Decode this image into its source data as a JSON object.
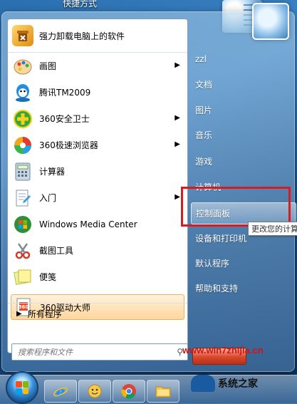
{
  "desktop": {
    "shortcut_label": "快捷方式"
  },
  "left_menu": {
    "pinned": {
      "label": "强力卸载电脑上的软件",
      "icon": "uninstall-icon"
    },
    "items": [
      {
        "label": "画图",
        "icon": "paint-icon",
        "has_submenu": true
      },
      {
        "label": "腾讯TM2009",
        "icon": "tencent-tm-icon",
        "has_submenu": false
      },
      {
        "label": "360安全卫士",
        "icon": "360-safe-icon",
        "has_submenu": true
      },
      {
        "label": "360极速浏览器",
        "icon": "360-browser-icon",
        "has_submenu": true
      },
      {
        "label": "计算器",
        "icon": "calculator-icon",
        "has_submenu": false
      },
      {
        "label": "入门",
        "icon": "getting-started-icon",
        "has_submenu": true
      },
      {
        "label": "Windows Media Center",
        "icon": "media-center-icon",
        "has_submenu": false
      },
      {
        "label": "截图工具",
        "icon": "snipping-tool-icon",
        "has_submenu": false
      },
      {
        "label": "便笺",
        "icon": "sticky-notes-icon",
        "has_submenu": false
      },
      {
        "label": "360驱动大师",
        "icon": "360-driver-icon",
        "has_submenu": false,
        "highlighted": true
      }
    ],
    "all_programs_label": "所有程序",
    "search_placeholder": "搜索程序和文件"
  },
  "right_menu": {
    "items": [
      {
        "label": "zzl"
      },
      {
        "label": "文档"
      },
      {
        "label": "图片"
      },
      {
        "label": "音乐"
      },
      {
        "label": "游戏"
      },
      {
        "label": "计算机"
      },
      {
        "label": "控制面板",
        "active": true
      },
      {
        "label": "设备和打印机"
      },
      {
        "label": "默认程序"
      },
      {
        "label": "帮助和支持"
      }
    ],
    "tooltip": "更改您的计算",
    "highlight_color": "#e0181a"
  },
  "watermark": {
    "url": "www.win7zhijia.cn",
    "brand": "系统之家"
  },
  "taskbar": {
    "buttons": [
      {
        "icon": "ie-icon"
      },
      {
        "icon": "messenger-icon"
      },
      {
        "icon": "chrome-icon"
      },
      {
        "icon": "explorer-icon"
      }
    ]
  }
}
